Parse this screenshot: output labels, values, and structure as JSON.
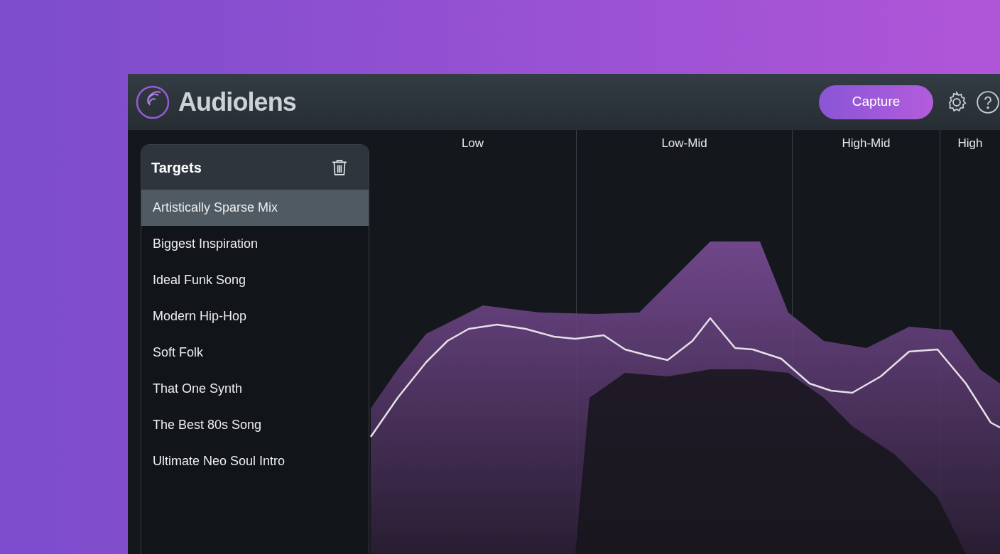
{
  "app": {
    "title": "Audiolens",
    "capture_button": "Capture"
  },
  "targets": {
    "title": "Targets",
    "items": [
      {
        "label": "Artistically Sparse Mix",
        "selected": true
      },
      {
        "label": "Biggest Inspiration",
        "selected": false
      },
      {
        "label": "Ideal Funk Song",
        "selected": false
      },
      {
        "label": "Modern Hip-Hop",
        "selected": false
      },
      {
        "label": "Soft Folk",
        "selected": false
      },
      {
        "label": "That One Synth",
        "selected": false
      },
      {
        "label": "The Best 80s Song",
        "selected": false
      },
      {
        "label": "Ultimate Neo Soul Intro",
        "selected": false
      }
    ]
  },
  "bands": [
    {
      "label": "Low"
    },
    {
      "label": "Low-Mid"
    },
    {
      "label": "High-Mid"
    },
    {
      "label": "High"
    }
  ]
}
